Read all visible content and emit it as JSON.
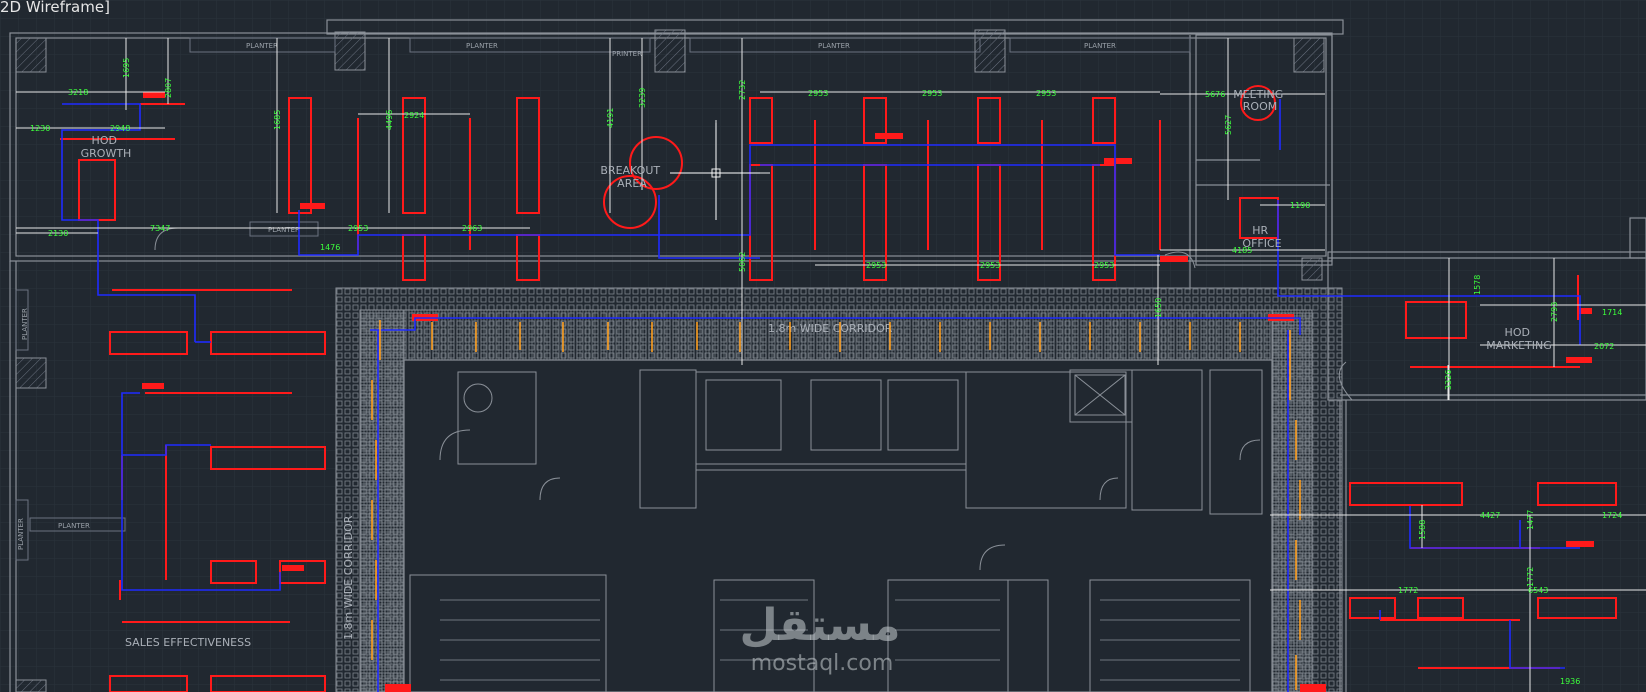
{
  "viewport": {
    "label": "2D Wireframe]"
  },
  "rooms": {
    "hod_growth": "HOD\nGROWTH",
    "breakout_area": "BREAKOUT\nAREA",
    "meeting_room": "MEETING\nROOM",
    "hr_office": "HR\nOFFICE",
    "hod_marketing": "HOD\nMARKETING",
    "sales_effectiveness": "SALES EFFECTIVENESS",
    "corridor_top": "1.8m WIDE CORRIDOR",
    "corridor_left": "1.8m WIDE CORRIDOR"
  },
  "planters": [
    "PLANTER",
    "PLANTER",
    "PLANTER",
    "PLANTER",
    "PLANTER",
    "PLANTER",
    "PLANTER",
    "PLANTER"
  ],
  "printer": "PRINTER",
  "dimensions": [
    "3218",
    "1230",
    "2948",
    "2130",
    "7347",
    "1476",
    "2953",
    "2924",
    "2963",
    "2953",
    "2953",
    "2953",
    "2953",
    "2953",
    "2953",
    "5676",
    "1190",
    "4185",
    "1714",
    "2072",
    "4427",
    "1724",
    "1772",
    "6543",
    "1936",
    "1695",
    "2807",
    "1685",
    "4496",
    "4191",
    "3239",
    "2732",
    "5062",
    "5627",
    "1650",
    "1578",
    "2793",
    "3326",
    "1477",
    "1588",
    "1772"
  ],
  "watermark": {
    "arabic": "مستقل",
    "latin": "mostaql.com"
  },
  "colors": {
    "background": "#212830",
    "wall": "#8a9098",
    "furniture": "#ff1a1a",
    "cable": "#1f2bff",
    "dimension": "#3cff3c",
    "outlet": "#ffa020"
  }
}
